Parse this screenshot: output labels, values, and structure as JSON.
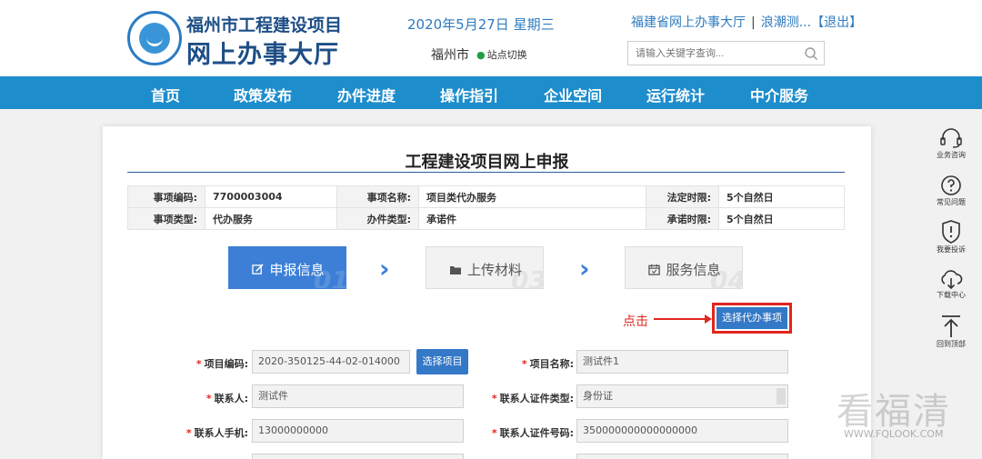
{
  "header": {
    "org_title": "福州市工程建设项目",
    "hall_title": "网上办事大厅",
    "date": "2020年5月27日  星期三",
    "city": "福州市",
    "site_switch": "站点切换",
    "provincial_link": "福建省网上办事大厅",
    "user": "浪潮测...",
    "logout": "【退出】",
    "search_placeholder": "请输入关键字查询..."
  },
  "nav": {
    "items": [
      "首页",
      "政策发布",
      "办件进度",
      "操作指引",
      "企业空间",
      "运行统计",
      "中介服务"
    ]
  },
  "panel": {
    "title": "工程建设项目网上申报",
    "info": {
      "code_label": "事项编码:",
      "code_value": "7700003004",
      "name_label": "事项名称:",
      "name_value": "项目类代办服务",
      "deadline_label": "法定时限:",
      "deadline_value": "5个自然日",
      "type_label": "事项类型:",
      "type_value": "代办服务",
      "case_type_label": "办件类型:",
      "case_type_value": "承诺件",
      "promise_label": "承诺时限:",
      "promise_value": "5个自然日"
    },
    "steps": [
      {
        "label": "申报信息",
        "num": "01",
        "icon": "edit-icon"
      },
      {
        "label": "上传材料",
        "num": "03",
        "icon": "folder-icon"
      },
      {
        "label": "服务信息",
        "num": "04",
        "icon": "calendar-icon"
      }
    ],
    "annotation": "点击",
    "select_agent_item_button": "选择代办事项",
    "form": {
      "project_code_label": "项目编码:",
      "project_code_value": "2020-350125-44-02-014000",
      "select_project_button": "选择项目",
      "project_name_label": "项目名称:",
      "project_name_value": "测试件1",
      "contact_label": "联系人:",
      "contact_value": "测试件",
      "id_type_label": "联系人证件类型:",
      "id_type_value": "身份证",
      "phone_label": "联系人手机:",
      "phone_value": "13000000000",
      "id_number_label": "联系人证件号码:",
      "id_number_value": "350000000000000000"
    }
  },
  "sidebar": {
    "items": [
      {
        "label": "业务咨询",
        "icon": "headset-icon"
      },
      {
        "label": "常见问题",
        "icon": "question-icon"
      },
      {
        "label": "我要投诉",
        "icon": "shield-alert-icon"
      },
      {
        "label": "下载中心",
        "icon": "cloud-download-icon"
      },
      {
        "label": "回到顶部",
        "icon": "back-to-top-icon"
      }
    ]
  },
  "watermark": {
    "text": "看福清",
    "url": "WWW.FQLOOK.COM"
  },
  "colors": {
    "nav_blue": "#1e8dcc",
    "brand_dark_blue": "#1d4e86",
    "button_blue": "#3478c8",
    "highlight_red": "#e0261d"
  }
}
